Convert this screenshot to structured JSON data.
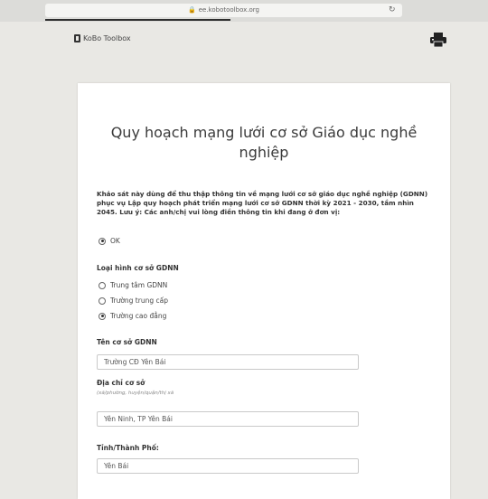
{
  "browser": {
    "lock_icon": "lock-icon",
    "url": "ee.kobotoolbox.org",
    "reload_icon": "reload-icon"
  },
  "header": {
    "logo_text": "KoBo Toolbox",
    "print_icon": "printer-icon"
  },
  "form": {
    "title": "Quy hoạch mạng lưới cơ sở Giáo dục nghề nghiệp",
    "intro": "Khảo sát này dùng để thu thập thông tin về mạng lưới cơ sở giáo dục nghề nghiệp (GDNN) phục vụ Lập quy hoạch phát triển mạng lưới cơ sở GDNN thời kỳ 2021 - 2030, tầm nhìn 2045. Lưu ý: Các anh/chị vui lòng điền thông tin khi đang ở đơn vị:",
    "ok_option": "OK",
    "ok_selected": true,
    "q_type": {
      "label": "Loại hình cơ sở GDNN",
      "options": [
        "Trung tâm GDNN",
        "Trường trung cấp",
        "Trường cao đẳng"
      ],
      "selected_index": 2
    },
    "q_name": {
      "label": "Tên cơ sở GDNN",
      "value": "Trường CĐ Yên Bái"
    },
    "q_address": {
      "label": "Địa chỉ cơ sở",
      "hint": "(xã/phường, huyện/quận/thị xã",
      "value": "Yên Ninh, TP Yên Bái"
    },
    "q_province": {
      "label": "Tỉnh/Thành Phố:",
      "value": "Yên Bái"
    }
  }
}
